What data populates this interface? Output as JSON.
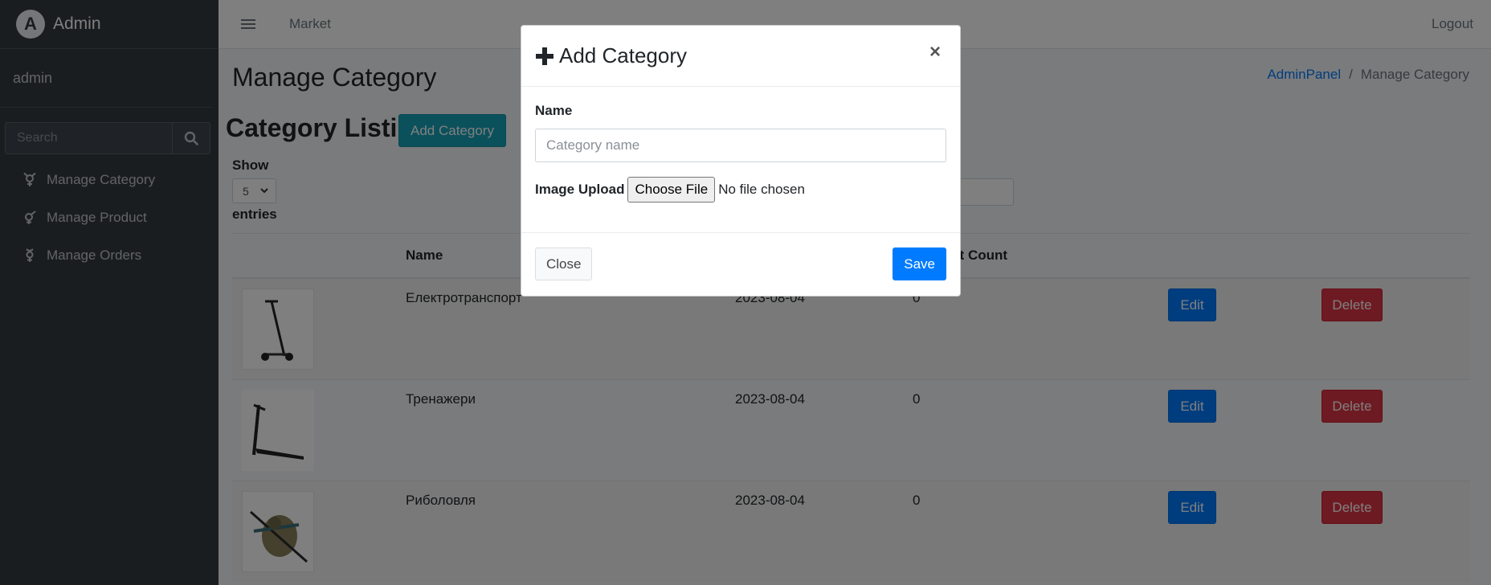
{
  "sidebar": {
    "brand": "Admin",
    "user": "admin",
    "search_placeholder": "Search",
    "items": [
      {
        "label": "Manage Category",
        "icon": "venus-mars-icon"
      },
      {
        "label": "Manage Product",
        "icon": "venus-icon"
      },
      {
        "label": "Manage Orders",
        "icon": "mercury-icon"
      }
    ]
  },
  "topbar": {
    "link": "Market",
    "logout": "Logout"
  },
  "page": {
    "title": "Manage Category",
    "breadcrumb": {
      "home": "AdminPanel",
      "current": "Manage Category"
    },
    "listing_title": "Category Listing",
    "add_button": "Add Category",
    "show_label": "Show",
    "entries_value": "5",
    "entries_label": "entries"
  },
  "table": {
    "headers": [
      "",
      "Name",
      "",
      "Product Count",
      "",
      ""
    ],
    "rows": [
      {
        "image": "electric-scooter-image",
        "name": "Електротранспорт",
        "date": "2023-08-04",
        "count": "0",
        "edit": "Edit",
        "delete": "Delete"
      },
      {
        "image": "treadmill-image",
        "name": "Тренажери",
        "date": "2023-08-04",
        "count": "0",
        "edit": "Edit",
        "delete": "Delete"
      },
      {
        "image": "fishing-gear-image",
        "name": "Риболовля",
        "date": "2023-08-04",
        "count": "0",
        "edit": "Edit",
        "delete": "Delete"
      }
    ]
  },
  "modal": {
    "title": "Add Category",
    "close_symbol": "×",
    "name_label": "Name",
    "name_placeholder": "Category name",
    "image_label": "Image Upload",
    "choose_file": "Choose File",
    "no_file": "No file chosen",
    "close_button": "Close",
    "save_button": "Save"
  },
  "colors": {
    "sidebar_bg": "#343a40",
    "primary": "#007bff",
    "info": "#17a2b8",
    "danger": "#dc3545",
    "backdrop": "rgba(0,0,0,0.5)"
  }
}
